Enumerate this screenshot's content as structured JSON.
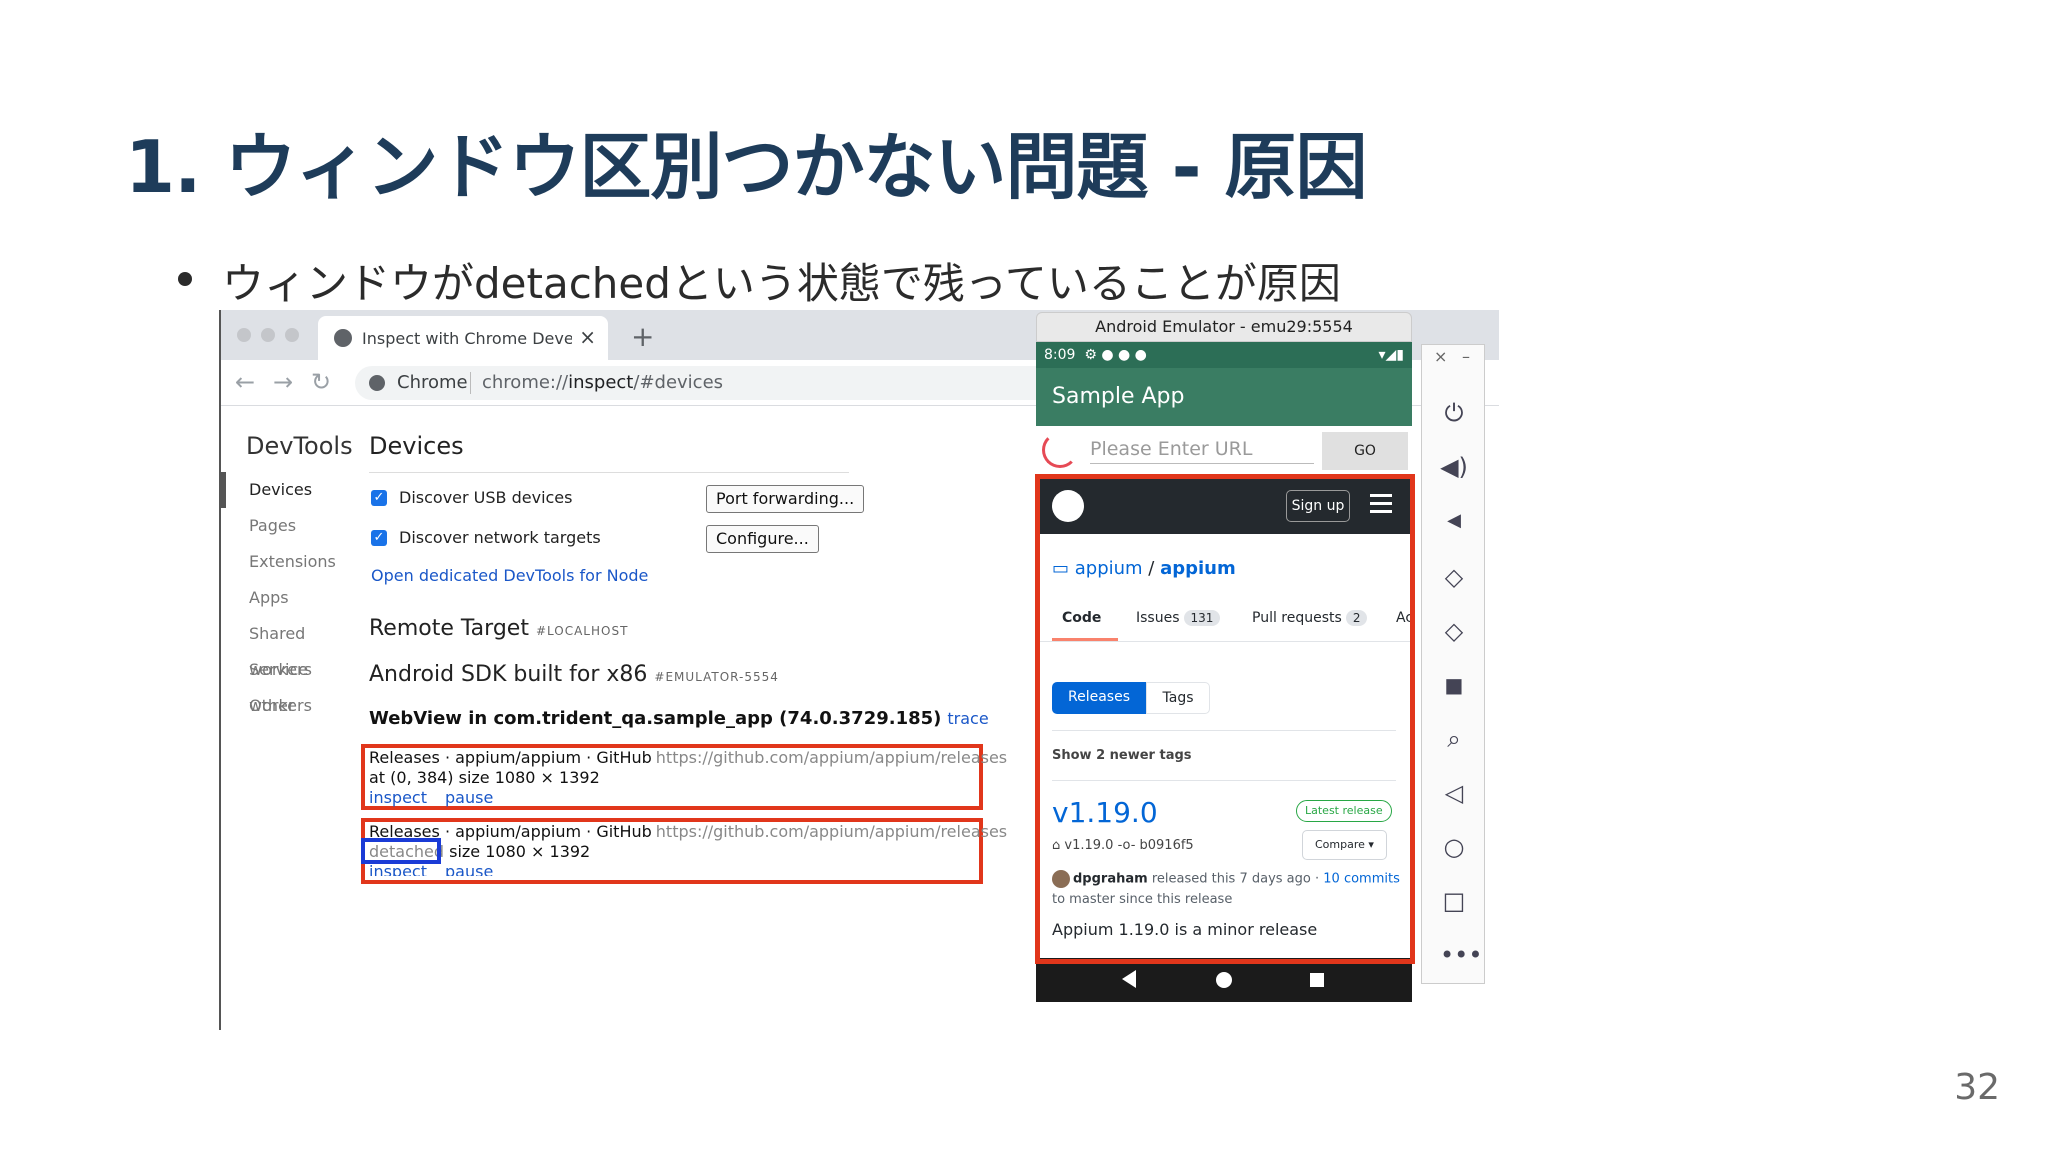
{
  "slide": {
    "title": "1. ウィンドウ区別つかない問題 - 原因",
    "bullet": "ウィンドウがdetachedという状態で残っていることが原因",
    "page_number": "32"
  },
  "browser": {
    "tab_title": "Inspect with Chrome Developer Tools",
    "tab_close": "×",
    "new_tab": "+",
    "omnibox_site": "Chrome",
    "omnibox_url_prefix": "chrome://",
    "omnibox_url_host": "inspect",
    "omnibox_url_suffix": "/#devices"
  },
  "devtools": {
    "brand": "DevTools",
    "nav": [
      "Devices",
      "Pages",
      "Extensions",
      "Apps",
      "Shared workers",
      "Service workers",
      "Other"
    ],
    "devices_heading": "Devices",
    "discover_usb": "Discover USB devices",
    "discover_network": "Discover network targets",
    "port_forwarding": "Port forwarding...",
    "configure": "Configure...",
    "node_link": "Open dedicated DevTools for Node",
    "remote_target": "Remote Target",
    "remote_target_sub": "#LOCALHOST",
    "device_name": "Android SDK built for x86",
    "device_sub": "#EMULATOR-5554",
    "webview_title": "WebView in com.trident_qa.sample_app (74.0.3729.185)",
    "trace": "trace",
    "targets": [
      {
        "title": "Releases · appium/appium · GitHub",
        "url": "https://github.com/appium/appium/releases",
        "info": "at (0, 384)  size 1080 × 1392",
        "inspect": "inspect",
        "pause": "pause"
      },
      {
        "title": "Releases · appium/appium · GitHub",
        "url": "https://github.com/appium/appium/releases",
        "detached": "detached",
        "info": "size 1080 × 1392",
        "inspect": "inspect",
        "pause": "pause"
      }
    ]
  },
  "emulator": {
    "title": "Android Emulator - emu29:5554",
    "time": "8:09",
    "app_title": "Sample App",
    "url_placeholder": "Please Enter URL",
    "go": "GO",
    "github": {
      "sign_up": "Sign up",
      "repo_owner": "appium",
      "repo_sep": " / ",
      "repo_name": "appium",
      "tabs": [
        {
          "label": "Code",
          "count": ""
        },
        {
          "label": "Issues",
          "count": "131"
        },
        {
          "label": "Pull requests",
          "count": "2"
        },
        {
          "label": "Ac",
          "count": ""
        }
      ],
      "releases_btn": "Releases",
      "tags_btn": "Tags",
      "show_newer": "Show 2 newer tags",
      "version": "v1.19.0",
      "latest_badge": "Latest release",
      "tag_line": "v1.19.0 -o- b0916f5",
      "compare": "Compare ▾",
      "author": "dpgraham",
      "released_text": " released this 7 days ago · ",
      "commits": "10 commits",
      "master_line": "to master since this release",
      "description": "Appium 1.19.0 is a minor release"
    },
    "side_icons": [
      "power-icon",
      "volume-up-icon",
      "volume-down-icon",
      "rotate-left-icon",
      "rotate-right-icon",
      "camera-icon",
      "zoom-icon",
      "back-icon",
      "home-icon",
      "overview-icon",
      "more-icon"
    ]
  }
}
